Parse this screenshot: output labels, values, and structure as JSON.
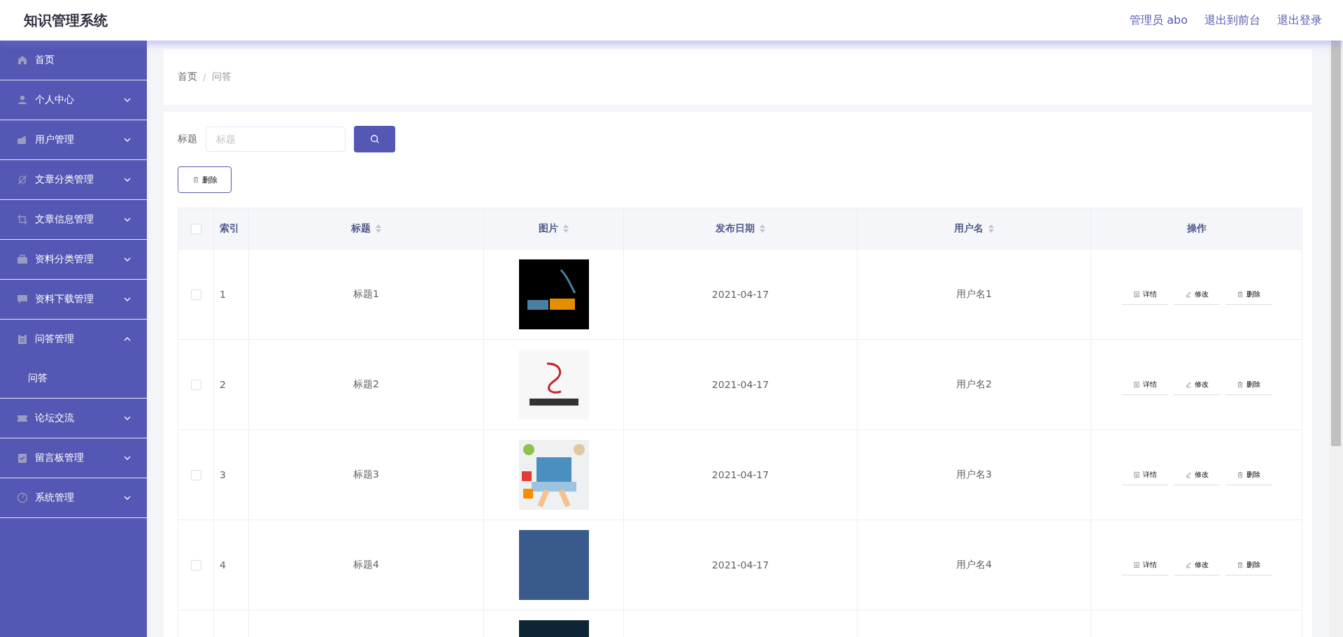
{
  "header": {
    "title": "知识管理系统",
    "links": [
      "管理员 abo",
      "退出到前台",
      "退出登录"
    ]
  },
  "sidebar": {
    "items": [
      {
        "label": "首页"
      },
      {
        "label": "个人中心",
        "expanded": false
      },
      {
        "label": "用户管理",
        "expanded": false
      },
      {
        "label": "文章分类管理",
        "expanded": false
      },
      {
        "label": "文章信息管理",
        "expanded": false
      },
      {
        "label": "资料分类管理",
        "expanded": false
      },
      {
        "label": "资料下载管理",
        "expanded": false
      },
      {
        "label": "问答管理",
        "expanded": true,
        "children": [
          {
            "label": "问答"
          }
        ]
      },
      {
        "label": "论坛交流",
        "expanded": false
      },
      {
        "label": "留言板管理",
        "expanded": false
      },
      {
        "label": "系统管理",
        "expanded": false
      }
    ]
  },
  "breadcrumb": {
    "items": [
      "首页",
      "问答"
    ],
    "separator": "/"
  },
  "search": {
    "label": "标题",
    "placeholder": "标题"
  },
  "delete_button": "删除",
  "table": {
    "select_all": {
      "checked": false
    },
    "columns": [
      {
        "label": "索引",
        "sortable": false
      },
      {
        "label": "标题",
        "sortable": true
      },
      {
        "label": "图片",
        "sortable": true
      },
      {
        "label": "发布日期",
        "sortable": true
      },
      {
        "label": "用户名",
        "sortable": true
      },
      {
        "label": "操作",
        "sortable": false
      }
    ],
    "rows": [
      {
        "checked": false,
        "index": "1",
        "title": "标题1",
        "picture": {
          "kind": "dark-logo"
        },
        "date": "2021-04-17",
        "user": "用户名1",
        "actions": [
          "详情",
          "修改",
          "删除"
        ]
      },
      {
        "checked": false,
        "index": "2",
        "title": "标题2",
        "picture": {
          "kind": "light-logo"
        },
        "date": "2021-04-17",
        "user": "用户名2",
        "actions": [
          "详情",
          "修改",
          "删除"
        ]
      },
      {
        "checked": false,
        "index": "3",
        "title": "标题3",
        "picture": {
          "kind": "illustration"
        },
        "date": "2021-04-17",
        "user": "用户名3",
        "actions": [
          "详情",
          "修改",
          "删除"
        ]
      },
      {
        "checked": false,
        "index": "4",
        "title": "标题4",
        "picture": {
          "kind": "photo"
        },
        "date": "2021-04-17",
        "user": "用户名4",
        "actions": [
          "详情",
          "修改",
          "删除"
        ]
      },
      {
        "picture": {
          "kind": "dark-photo"
        }
      }
    ]
  }
}
